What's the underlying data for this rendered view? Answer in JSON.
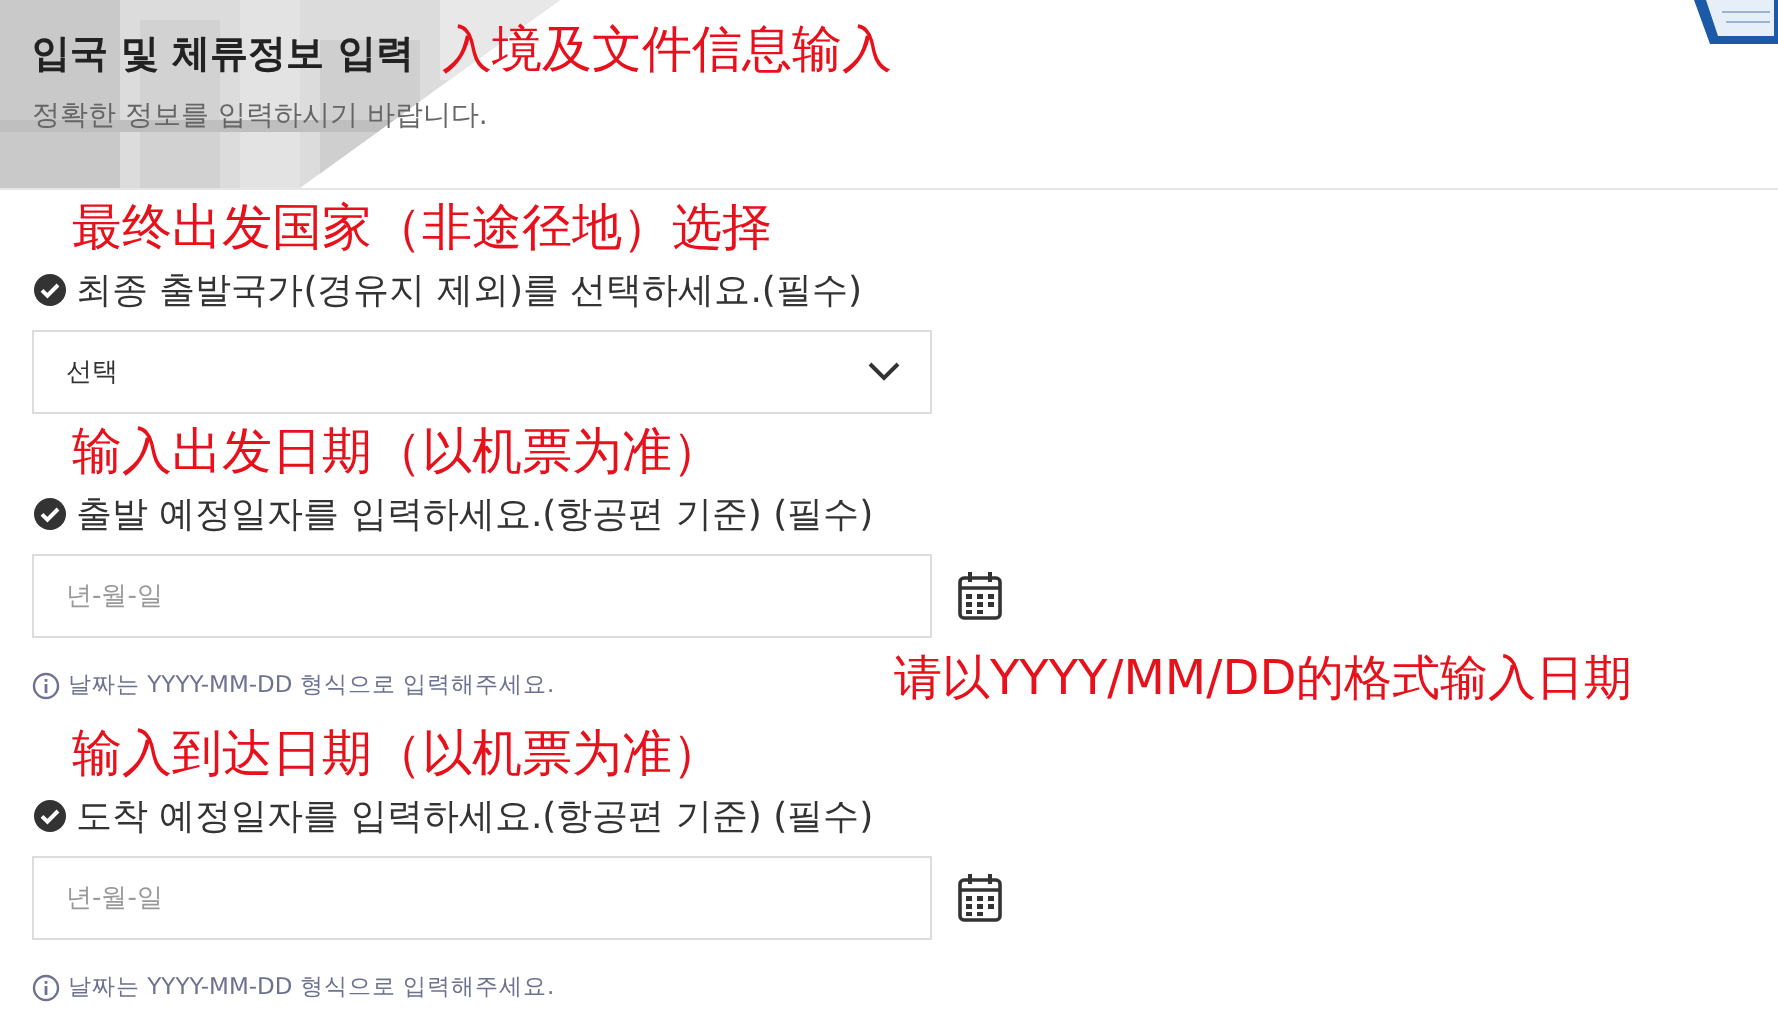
{
  "header": {
    "title": "입국 및 체류정보 입력",
    "title_annotation": "入境及文件信息输入",
    "subtitle": "정확한 정보를 입력하시기 바랍니다."
  },
  "fields": [
    {
      "kind": "select",
      "annotation": "最终出发国家（非途径地）选择",
      "label": "최종 출발국가(경유지 제외)를 선택하세요.(필수)",
      "value": "선택"
    },
    {
      "kind": "date",
      "annotation": "输入出发日期（以机票为准）",
      "label": "출발 예정일자를 입력하세요.(항공편 기준) (필수)",
      "placeholder": "년-월-일",
      "hint": "날짜는 YYYY-MM-DD 형식으로 입력해주세요.",
      "side_annotation": "请以YYYY/MM/DD的格式输入日期"
    },
    {
      "kind": "date",
      "annotation": "输入到达日期（以机票为准）",
      "label": "도착 예정일자를 입력하세요.(항공편 기준) (필수)",
      "placeholder": "년-월-일",
      "hint": "날짜는 YYYY-MM-DD 형식으로 입력해주세요."
    }
  ]
}
